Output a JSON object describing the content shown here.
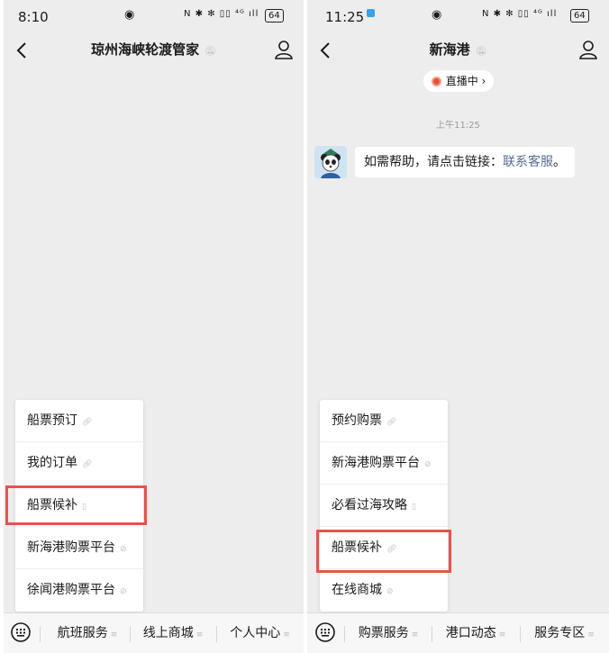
{
  "left": {
    "status": {
      "time": "8:10"
    },
    "title": "琼州海峡轮渡管家",
    "menu": [
      "船票预订",
      "我的订单",
      "船票候补",
      "新海港购票平台",
      "徐闻港购票平台"
    ],
    "tabs": [
      "航班服务",
      "线上商城",
      "个人中心"
    ]
  },
  "right": {
    "status": {
      "time": "11:25"
    },
    "title": "新海港",
    "live_label": "直播中 ›",
    "timestamp": "上午11:25",
    "message": {
      "text": "如需帮助，请点击链接：",
      "link": "联系客服",
      "end": "。"
    },
    "menu": [
      "预约购票",
      "新海港购票平台",
      "必看过海攻略",
      "船票候补",
      "在线商城"
    ],
    "tabs": [
      "购票服务",
      "港口动态",
      "服务专区"
    ]
  },
  "status_common": {
    "battery": "64"
  },
  "colors": {
    "highlight": "#e5544c",
    "link": "#576b95",
    "background": "#ededed"
  }
}
